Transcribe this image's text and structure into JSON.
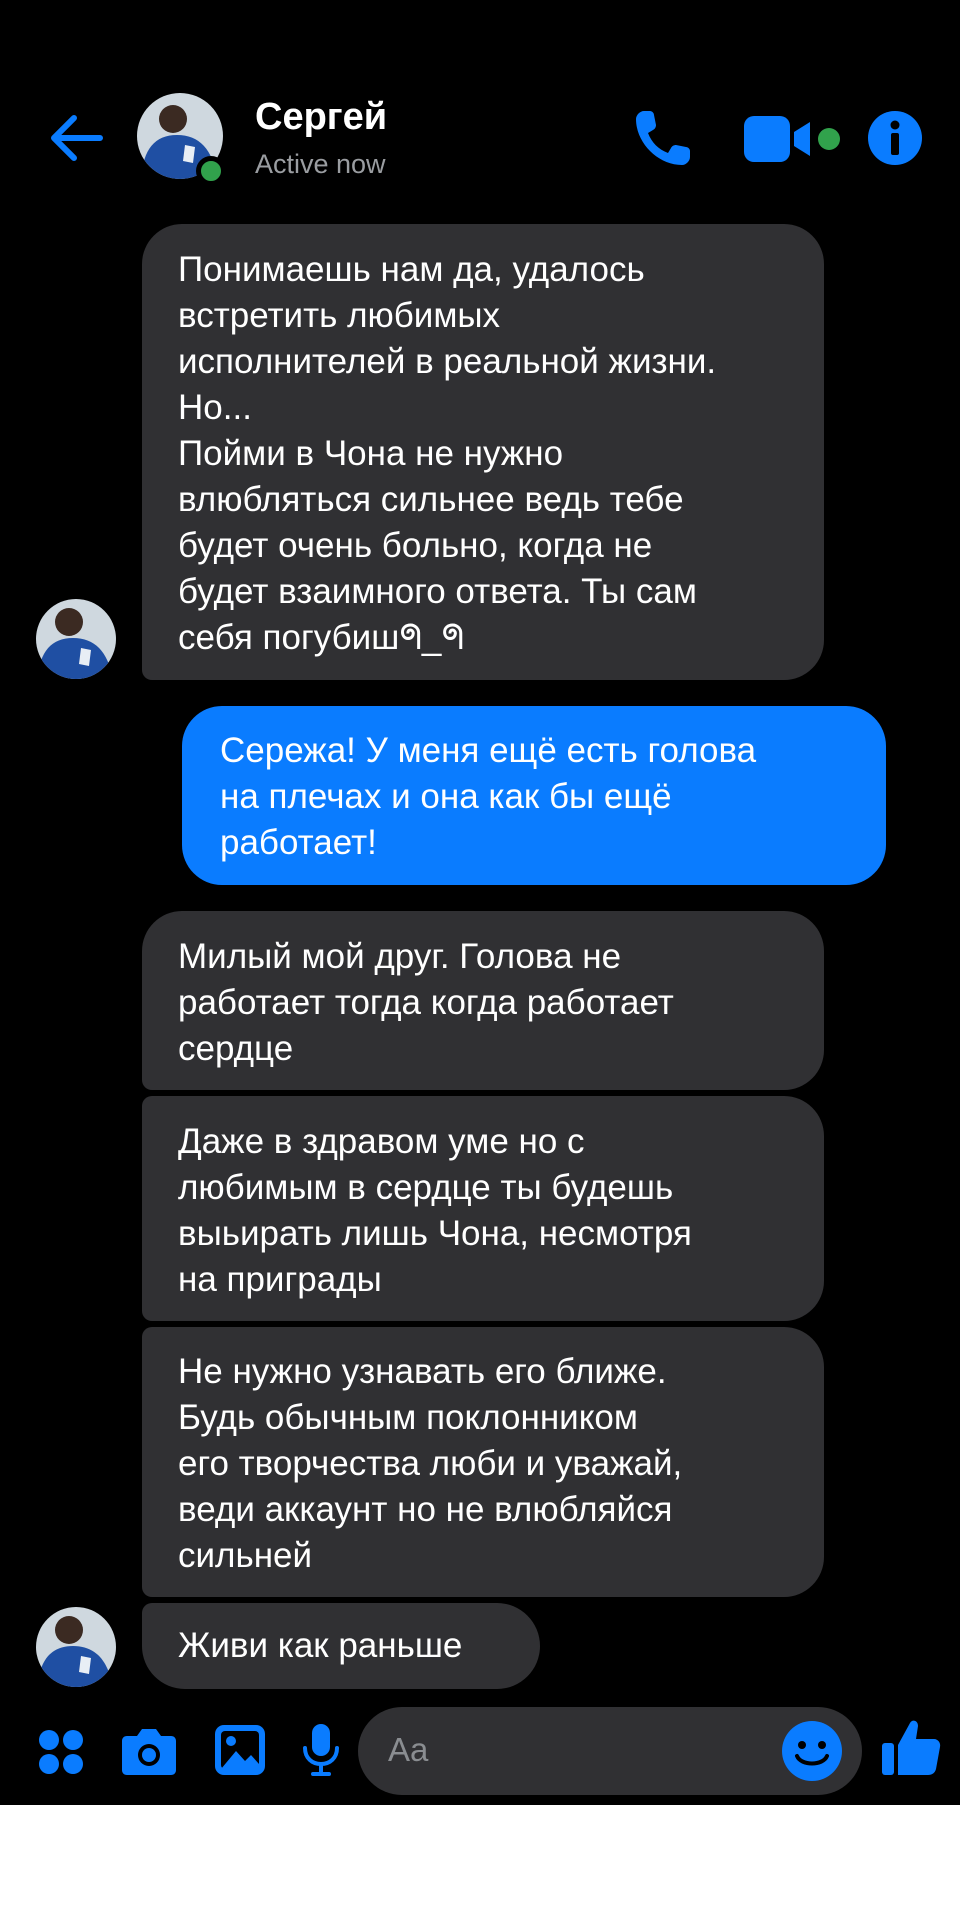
{
  "header": {
    "contact_name": "Сергей",
    "status": "Active now"
  },
  "messages": [
    {
      "direction": "incoming",
      "text": "Понимаешь нам да, удалось\nвстретить любимых\nисполнителей в реальной жизни.\nНо...\nПойми в Чона не нужно\nвлюбляться сильнее ведь тебе\nбудет очень больно, когда не\nбудет взаимного ответа. Ты сам\nсебя погубишᖗ_ᖗ"
    },
    {
      "direction": "outgoing",
      "text": "Сережа! У меня ещё есть голова\nна плечах и она как бы ещё\nработает!"
    },
    {
      "direction": "incoming",
      "text": "Милый мой друг. Голова не\nработает тогда когда работает\nсердце"
    },
    {
      "direction": "incoming",
      "text": "Даже в здравом уме но с\nлюбимым в сердце ты будешь\nвыьирать лишь Чона, несмотря\nна приграды"
    },
    {
      "direction": "incoming",
      "text": "Не нужно узнавать его ближе.\nБудь обычным поклонником\nего творчества люби и уважай,\nведи аккаунт но не влюбляйся\nсильней"
    },
    {
      "direction": "incoming",
      "text": "Живи как раньше"
    }
  ],
  "composer": {
    "placeholder": "Aa"
  },
  "icons": {
    "back": "arrow-left-icon",
    "call": "phone-icon",
    "video": "video-camera-icon",
    "info": "info-icon",
    "apps": "grid-dots-icon",
    "camera": "camera-icon",
    "gallery": "image-icon",
    "voice": "microphone-icon",
    "emoji": "smiley-icon",
    "like": "thumbs-up-icon"
  },
  "colors": {
    "accent": "#0a7cff",
    "background": "#000000",
    "incoming_bubble": "#303033",
    "online": "#31a24c",
    "secondary_text": "#9a9da1"
  }
}
